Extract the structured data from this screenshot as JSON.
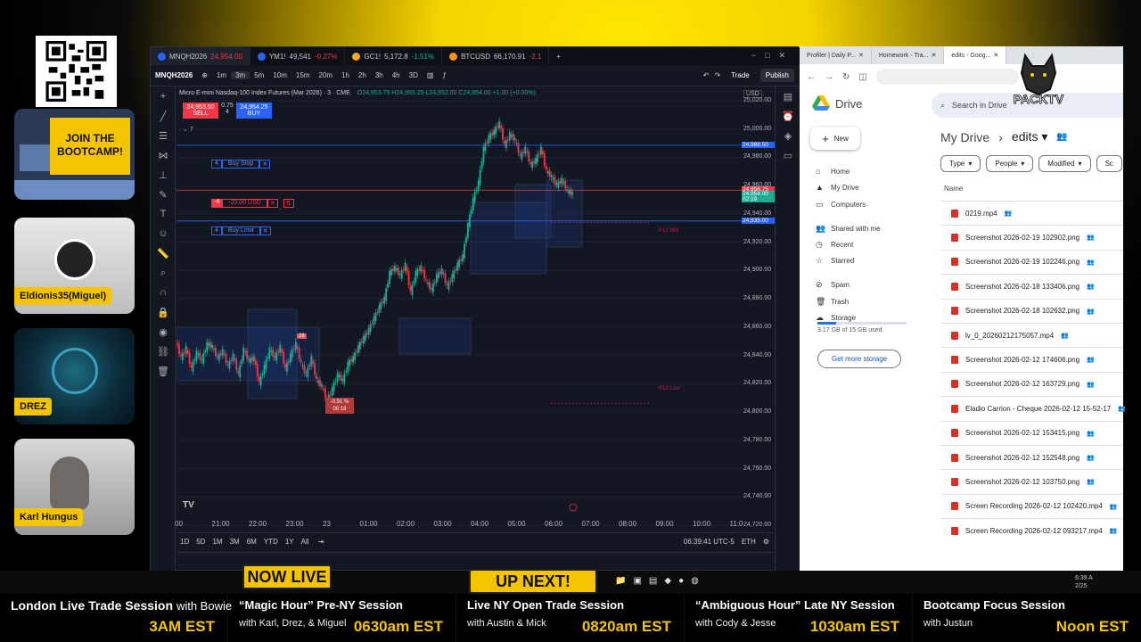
{
  "promo": {
    "bootcamp_line1": "JOIN THE",
    "bootcamp_line2": "BOOTCAMP!"
  },
  "cams": [
    {
      "name": "Eldionis35(Miguel)"
    },
    {
      "name": "DREZ"
    },
    {
      "name": "Karl Hungus"
    }
  ],
  "chart_tabs": [
    {
      "symbol": "MNQH2026",
      "price": "24,954.00",
      "change": "",
      "color": "#2962ff"
    },
    {
      "symbol": "YM1!",
      "price": "49,541",
      "change": "-0.27%",
      "color": "#2962ff"
    },
    {
      "symbol": "GC1!",
      "price": "5,172.8",
      "change": "-1.51%",
      "color": "#f5a623"
    },
    {
      "symbol": "BTCUSD",
      "price": "66,170.91",
      "change": "-2.1",
      "color": "#f7931a"
    }
  ],
  "toolbar": {
    "symbol": "MNQH2026",
    "intervals": [
      "1m",
      "3m",
      "5m",
      "10m",
      "15m",
      "20m",
      "1h",
      "2h",
      "3h",
      "4h",
      "3D"
    ],
    "selected_interval": "3m",
    "trade_label": "Trade",
    "publish_label": "Publish"
  },
  "chart_header": {
    "title": "Micro E-mini Nasdaq-100 Index Futures (Mar 2026) · 3 · CME",
    "ohlc": "O24,953.75 H24,955.25 L24,952.00 C24,954.00 +1.00 (+0.00%)",
    "sell_price": "24,953.50",
    "sell_label": "SELL",
    "spread": "0.75",
    "qty": "4",
    "buy_price": "24,954.25",
    "buy_label": "BUY",
    "indicator_count": "7",
    "currency": "USD"
  },
  "orders": {
    "buy_stop": {
      "qty": "4",
      "label": "Buy Stop"
    },
    "position": {
      "qty": "-4",
      "pnl": "-20.00 USD"
    },
    "buy_limit": {
      "qty": "4",
      "label": "Buy Limit"
    }
  },
  "chart_labels": {
    "pd_mid": "P12 Mid",
    "pd_low": "P12 Low",
    "drop_pct": "-0.91 %",
    "drop_time": "00:18",
    "marker_a": "28"
  },
  "price_axis": {
    "ticks": [
      "25,020.00",
      "25,000.00",
      "24,980.00",
      "24,960.00",
      "24,940.00",
      "24,920.00",
      "24,900.00",
      "24,880.00",
      "24,860.00",
      "24,840.00",
      "24,820.00",
      "24,800.00",
      "24,780.00",
      "24,760.00",
      "24,740.00",
      "24,720.00"
    ],
    "tag_stop": "24,988.50",
    "tag_red": "24,956.75",
    "tag_last": "24,954.00",
    "tag_countdown": "02:19",
    "tag_limit": "24,935.00"
  },
  "time_axis": [
    "00",
    "21:00",
    "22:00",
    "23:00",
    "23",
    "01:00",
    "02:00",
    "03:00",
    "04:00",
    "05:00",
    "06:00",
    "07:00",
    "08:00",
    "09:00",
    "10:00",
    "11:0"
  ],
  "bottom_bar": {
    "ranges": [
      "1D",
      "5D",
      "1M",
      "3M",
      "6M",
      "YTD",
      "1Y",
      "All"
    ],
    "clock": "06:39:41 UTC-5",
    "session": "ETH"
  },
  "drive": {
    "tabs": [
      "Profiler | Daily P...",
      "Homework - Tra...",
      "edits - Goog..."
    ],
    "brand": "Drive",
    "search_placeholder": "Search in Drive",
    "new_label": "New",
    "nav": [
      "Home",
      "My Drive",
      "Computers",
      "Shared with me",
      "Recent",
      "Starred",
      "Spam",
      "Trash",
      "Storage"
    ],
    "quota": "3.17 GB of 15 GB used",
    "quota_fraction": 0.21,
    "get_more": "Get more storage",
    "breadcrumb_root": "My Drive",
    "breadcrumb_current": "edits",
    "filters": [
      "Type",
      "People",
      "Modified",
      "Sc"
    ],
    "column_name": "Name",
    "files": [
      "0219.mp4",
      "Screenshot 2026-02-19 102902.png",
      "Screenshot 2026-02-19 102246.png",
      "Screenshot 2026-02-18 133406.png",
      "Screenshot 2026-02-18 102632.png",
      "lv_0_20260212175057.mp4",
      "Screenshot 2026-02-12 174606.png",
      "Screenshot 2026-02-12 163729.png",
      "Eladio Carrion - Cheque 2026-02-12 15-52-17",
      "Screenshot 2026-02-12 153415.png",
      "Screenshot 2026-02-12 152548.png",
      "Screenshot 2026-02-12 103750.png",
      "Screen Recording 2026-02-12 102420.mp4",
      "Screen Recording 2026-02-12 093217.mp4"
    ]
  },
  "logo": {
    "text": "PACKTV"
  },
  "badges": {
    "now_live": "NOW LIVE",
    "up_next": "UP NEXT!"
  },
  "taskbar": {
    "time": "6:39 A",
    "date": "2/25"
  },
  "schedule": [
    {
      "title": "London Live Trade Session",
      "with": "with Bowie",
      "sub": "",
      "time": "3AM EST"
    },
    {
      "title": "“Magic Hour” Pre-NY Session",
      "with": "",
      "sub": "with Karl, Drez, & Miguel",
      "time": "0630am EST"
    },
    {
      "title": "Live NY Open Trade Session",
      "with": "",
      "sub": "with Austin & Mick",
      "time": "0820am EST"
    },
    {
      "title": "“Ambiguous Hour” Late NY Session",
      "with": "",
      "sub": "with Cody & Jesse",
      "time": "1030am EST"
    },
    {
      "title": "Bootcamp Focus Session",
      "with": "",
      "sub": "with Justun",
      "time": "Noon EST"
    }
  ],
  "colors": {
    "accent_yellow": "#f5c400",
    "tv_bg": "#131722",
    "up": "#22ab94",
    "down": "#f23645",
    "order_blue": "#2962ff"
  },
  "chart_data": {
    "type": "candlestick",
    "title": "Micro E-mini Nasdaq-100 Index Futures (Mar 2026) · 3 · CME",
    "ylim": [
      24710,
      25030
    ],
    "x": [
      "21:00",
      "22:00",
      "23:00",
      "23",
      "01:00",
      "02:00",
      "03:00",
      "04:00",
      "05:00",
      "06:00",
      "07:00"
    ],
    "path": [
      24850,
      24838,
      24845,
      24830,
      24842,
      24836,
      24848,
      24846,
      24838,
      24843,
      24832,
      24840,
      24826,
      24844,
      24836,
      24838,
      24820,
      24832,
      24844,
      24838,
      24846,
      24830,
      24840,
      24848,
      24834,
      24826,
      24838,
      24822,
      24818,
      24808,
      24816,
      24826,
      24822,
      24834,
      24838,
      24846,
      24852,
      24858,
      24866,
      24874,
      24880,
      24898,
      24902,
      24896,
      24904,
      24884,
      24898,
      24902,
      24892,
      24886,
      24896,
      24900,
      24888,
      24896,
      24904,
      24910,
      24932,
      24950,
      24962,
      24986,
      24994,
      24998,
      25004,
      24988,
      24996,
      24992,
      24980,
      24986,
      24974,
      24978,
      24986,
      24970,
      24966,
      24960,
      24964,
      24956,
      24954
    ]
  }
}
